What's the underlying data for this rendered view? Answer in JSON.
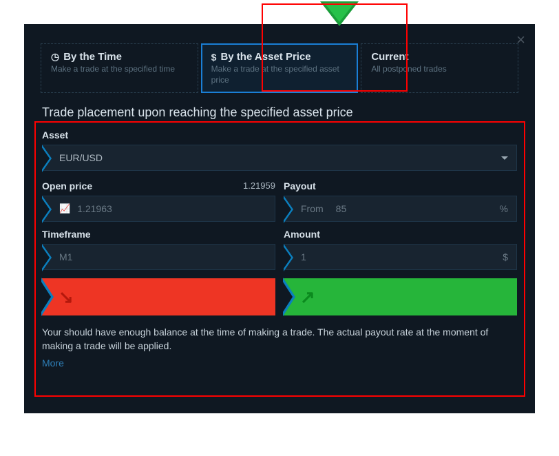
{
  "tabs": {
    "time": {
      "label": "By the Time",
      "desc": "Make a trade at the specified time"
    },
    "price": {
      "label": "By the Asset Price",
      "desc": "Make a trade at the specified asset price"
    },
    "current": {
      "label": "Current",
      "desc": "All postponed trades"
    }
  },
  "section_title": "Trade placement upon reaching the specified asset price",
  "asset": {
    "label": "Asset",
    "value": "EUR/USD"
  },
  "open_price": {
    "label": "Open price",
    "hint": "1.21959",
    "value": "1.21963"
  },
  "payout": {
    "label": "Payout",
    "prefix": "From",
    "value": "85",
    "unit": "%"
  },
  "timeframe": {
    "label": "Timeframe",
    "value": "M1"
  },
  "amount": {
    "label": "Amount",
    "value": "1",
    "unit": "$"
  },
  "note": "Your should have enough balance at the time of making a trade. The actual payout rate at the moment of making a trade will be applied.",
  "more": "More"
}
